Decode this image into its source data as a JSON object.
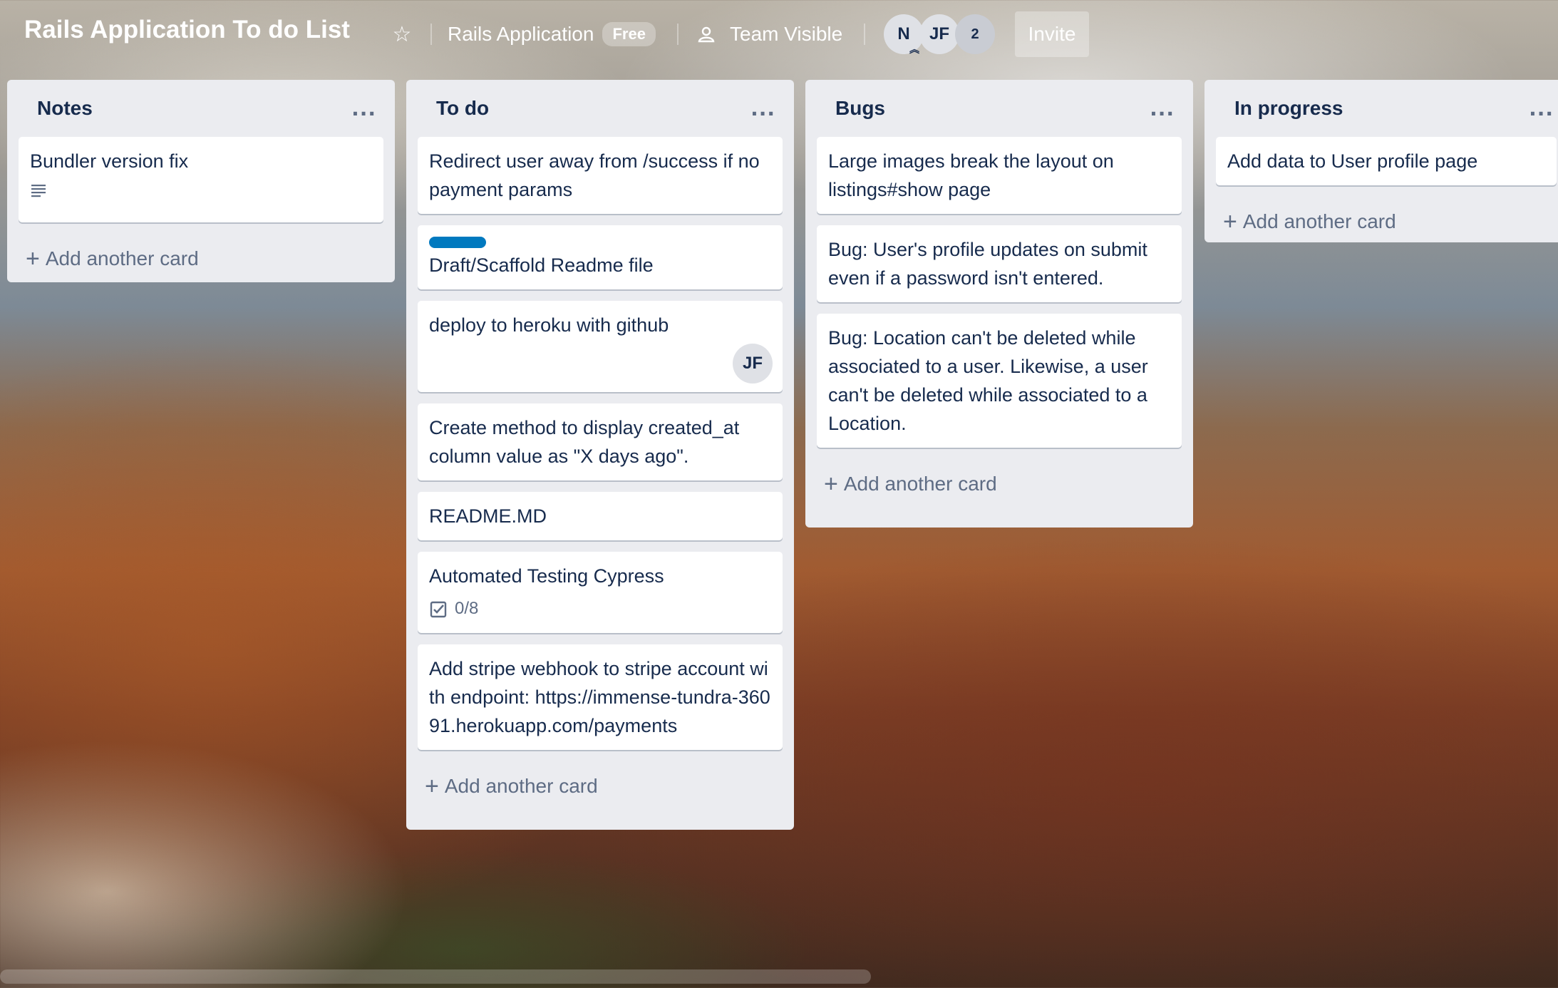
{
  "board": {
    "title": "Rails Application To do List",
    "team_name": "Rails Application",
    "plan_badge": "Free",
    "visibility": "Team Visible",
    "members": [
      "N",
      "JF"
    ],
    "member_overflow": "2",
    "invite_label": "Invite"
  },
  "colors": {
    "label_blue": "#0079bf",
    "list_bg": "#ebecf0",
    "text_primary": "#172b4d",
    "text_muted": "#5e6c84"
  },
  "lists": [
    {
      "title": "Notes",
      "menu": "...",
      "cards": [
        {
          "text": "Bundler version fix",
          "badge": "description-icon"
        }
      ],
      "add_label": "Add another card"
    },
    {
      "title": "To do",
      "menu": "...",
      "cards": [
        {
          "text": "Redirect user away from /success if no payment params"
        },
        {
          "text": "Draft/Scaffold Readme file",
          "label_color": "#0079bf"
        },
        {
          "text": "deploy to heroku with github",
          "member": "JF"
        },
        {
          "text": "Create method to display created_at column value as \"X days ago\"."
        },
        {
          "text": "README.MD"
        },
        {
          "text": "Automated Testing Cypress",
          "checklist": "0/8"
        },
        {
          "text": "Add stripe webhook to stripe account with endpoint: https://immense-tundra-36091.herokuapp.com/payments"
        }
      ],
      "add_label": "Add another card"
    },
    {
      "title": "Bugs",
      "menu": "...",
      "cards": [
        {
          "text": "Large images break the layout on listings#show page"
        },
        {
          "text": "Bug: User's profile updates on submit even if a password isn't entered."
        },
        {
          "text": "Bug: Location can't be deleted while associated to a user. Likewise, a user can't be deleted while associated to a Location."
        }
      ],
      "add_label": "Add another card"
    },
    {
      "title": "In progress",
      "menu": "...",
      "cards": [
        {
          "text": "Add data to User profile page"
        }
      ],
      "add_label": "Add another card"
    }
  ]
}
